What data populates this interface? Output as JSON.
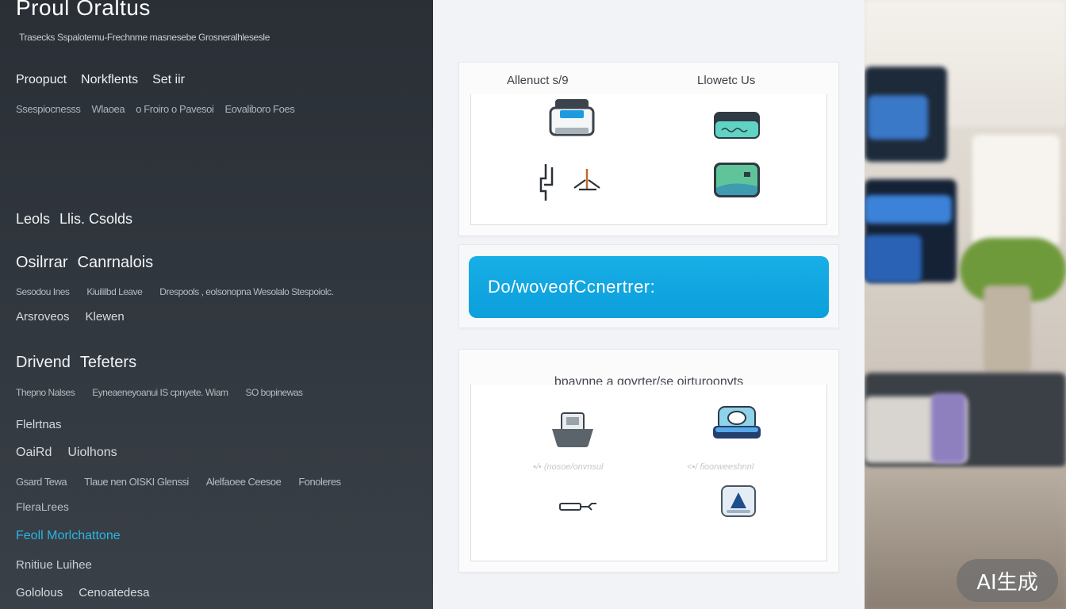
{
  "sidebar": {
    "title": "Proul Oraltus",
    "subtitle": "Trasecks Sspalotemu-Frechnme masnesebe Grosneralhlesesle",
    "nav_top": [
      "Proopuct",
      "Norkflents",
      "Set iir"
    ],
    "nav_sub": [
      "Ssespiocnesss",
      "Wlaoea",
      "o Froiro o Pavesoi",
      "Eovaliboro Foes"
    ],
    "leads_row": [
      "Leols",
      "Llis. Csolds"
    ],
    "osirar_heading": [
      "Osilrrar",
      "Canrnalois"
    ],
    "osirar_small": [
      "Sesodou Ines",
      "Kiuililbd Leave",
      "Drespools , eolsonopna Wesolalo Stespoiolc."
    ],
    "approves_row": [
      "Arsroveos",
      "Klewen"
    ],
    "drivend_heading": [
      "Drivend",
      "Tefeters"
    ],
    "drivend_small": [
      "Thepno Nalses",
      "Eyneaeneyoanui IS cpnyete. Wiam",
      "SO bopinewas"
    ],
    "fleirtnas": "Flelrtnas",
    "oaird_row": [
      "OaiRd",
      "Uiolhons"
    ],
    "gsard_small": [
      "Gsard Tewa",
      "Tlaue nen OISKI Glenssi",
      "Alelfaoee Ceesoe",
      "Fonoleres"
    ],
    "flealutes": "FleraLrees",
    "pearl_active": "Feoll Morlchattone",
    "anticue": "Rnitiue Luihee",
    "gobious_row": [
      "Gololous",
      "Cenoatedesa"
    ],
    "accent_color": "#29b6e8"
  },
  "main": {
    "top_card": {
      "left_label": "Allenuct ѕ/9",
      "right_label": "Llowetc Us",
      "icons": [
        "printer-icon",
        "drive-icon",
        "tool-icon",
        "card-icon"
      ]
    },
    "cta": {
      "label": "Do/woveofCcnertrer:",
      "color": "#0ea5e0"
    },
    "bottom_card": {
      "label": "bpavnne a goyrter/se oirturoonvts",
      "faint_labels": [
        "•/• (nosoe/onvnsul",
        "<•/ fioorweeshnnl"
      ],
      "icons": [
        "cart-icon",
        "scanner-icon",
        "cable-icon",
        "triangle-badge-icon"
      ]
    }
  },
  "watermark": "AI生成"
}
